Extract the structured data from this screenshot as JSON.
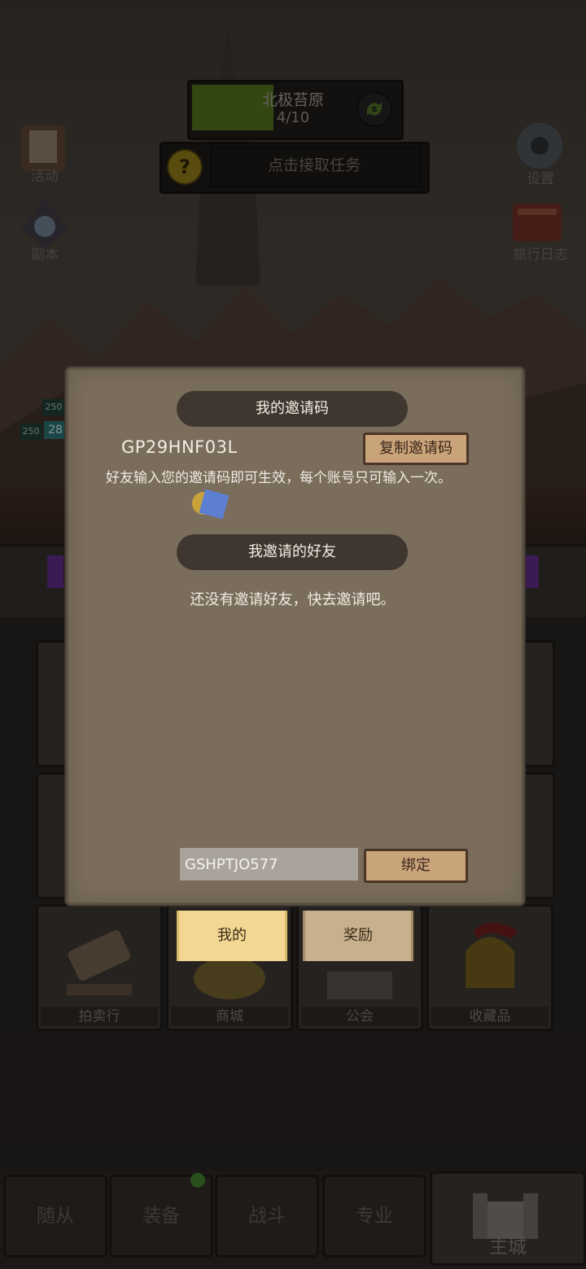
{
  "hud": {
    "region_name": "北极苔原",
    "region_progress": "4/10",
    "task_prompt": "点击接取任务",
    "left_icons": [
      "活动",
      "副本"
    ],
    "right_icons": [
      "设置",
      "旅行日志"
    ]
  },
  "hp_badges": [
    "250",
    "250",
    "28"
  ],
  "grid_tiles": [
    "拍卖行",
    "商城",
    "公会",
    "收藏品"
  ],
  "bottom_nav": [
    "随从",
    "装备",
    "战斗",
    "专业",
    "主城"
  ],
  "dialog": {
    "my_code_title": "我的邀请码",
    "my_code": "GP29HNF03L",
    "copy_button": "复制邀请码",
    "info": "好友输入您的邀请码即可生效，每个账号只可输入一次。",
    "friends_title": "我邀请的好友",
    "empty_message": "还没有邀请好友，快去邀请吧。",
    "bind_input_value": "GSHPTJO577",
    "bind_button": "绑定"
  },
  "dialog_tabs": {
    "mine": "我的",
    "reward": "奖励"
  },
  "colors": {
    "dialog_bg": "#7a6d5b",
    "banner_bg": "#3f372f",
    "tab_active": "#f1d792",
    "wood_button": "#c9a37a"
  }
}
